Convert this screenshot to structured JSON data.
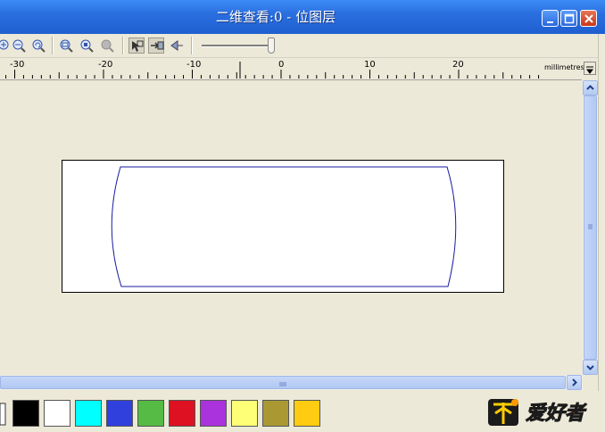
{
  "window": {
    "title": "二维查看:0 - 位图层"
  },
  "toolbar": {
    "buttons": [
      "zoom-in-icon",
      "zoom-out-icon",
      "zoom-previous-icon",
      "zoom-fit-icon",
      "zoom-window-icon",
      "zoom-disabled-icon",
      "select-tool-icon",
      "move-tool-icon",
      "pan-tool-icon"
    ],
    "slider_level": 0.95
  },
  "ruler": {
    "labels": [
      "-30",
      "-20",
      "-10",
      "0",
      "10",
      "20"
    ],
    "unit": "millimetres"
  },
  "drawing": {
    "frame_color": "#000000",
    "shape_color": "#1a1aa0",
    "description_icon": "rounded-barrel-outline"
  },
  "palette": {
    "colors": [
      "#000000",
      "#ffffff",
      "#00ffff",
      "#3040dd",
      "#55bb44",
      "#dd1122",
      "#aa33dd",
      "#ffff77",
      "#aa9933",
      "#ffcc11"
    ]
  },
  "logo": {
    "text": "爱好者"
  }
}
